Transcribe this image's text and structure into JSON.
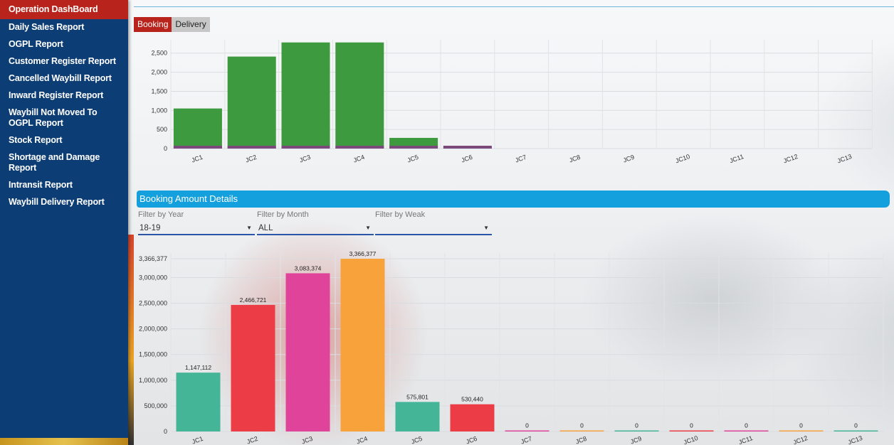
{
  "sidebar": {
    "items": [
      {
        "label": "Operation DashBoard",
        "active": true
      },
      {
        "label": "Daily Sales Report"
      },
      {
        "label": "OGPL Report"
      },
      {
        "label": "Customer Register Report"
      },
      {
        "label": "Cancelled Waybill Report"
      },
      {
        "label": "Inward Register Report"
      },
      {
        "label": "Waybill Not Moved To OGPL Report"
      },
      {
        "label": "Stock Report"
      },
      {
        "label": "Shortage and Damage Report"
      },
      {
        "label": "Intransit Report"
      },
      {
        "label": "Waybill Delivery Report"
      }
    ]
  },
  "tabs": [
    {
      "label": "Booking",
      "active": true
    },
    {
      "label": "Delivery",
      "active": false
    }
  ],
  "booking_amount": {
    "title": "Booking Amount Details",
    "filters": [
      {
        "label": "Filter by Year",
        "value": "18-19"
      },
      {
        "label": "Filter by Month",
        "value": "ALL"
      },
      {
        "label": "Filter by Weak",
        "value": ""
      }
    ]
  },
  "colors": {
    "sidebar_bg": "#0d3d75",
    "active_red": "#b8241c",
    "header_blue": "#14a0dc",
    "green": "#3e9a3e",
    "teal": "#45b597",
    "red": "#ec3d46",
    "magenta": "#e0449a",
    "orange": "#f8a23c"
  },
  "chart_data": [
    {
      "type": "bar",
      "categories": [
        "JC1",
        "JC2",
        "JC3",
        "JC4",
        "JC5",
        "JC6",
        "JC7",
        "JC8",
        "JC9",
        "JC10",
        "JC11",
        "JC12",
        "JC13"
      ],
      "values": [
        1050,
        2410,
        2780,
        2780,
        280,
        35,
        0,
        0,
        0,
        0,
        0,
        0,
        0
      ],
      "ylim": [
        0,
        2700
      ],
      "yticks": [
        "0",
        "500",
        "1,000",
        "1,500",
        "2,000",
        "2,500"
      ],
      "grid": true,
      "colors": [
        "#3e9a3e"
      ]
    },
    {
      "type": "bar",
      "categories": [
        "JC1",
        "JC2",
        "JC3",
        "JC4",
        "JC5",
        "JC6",
        "JC7",
        "JC8",
        "JC9",
        "JC10",
        "JC11",
        "JC12",
        "JC13"
      ],
      "values": [
        1147112,
        2466721,
        3083374,
        3366377,
        575801,
        530440,
        0,
        0,
        0,
        0,
        0,
        0,
        0
      ],
      "data_labels": [
        "1,147,112",
        "2,466,721",
        "3,083,374",
        "3,366,377",
        "575,801",
        "530,440",
        "0",
        "0",
        "0",
        "0",
        "0",
        "0",
        "0"
      ],
      "ylim": [
        0,
        3366377
      ],
      "yticks": [
        "0",
        "500,000",
        "1,000,000",
        "1,500,000",
        "2,000,000",
        "2,500,000",
        "3,000,000",
        "3,366,377"
      ],
      "grid": true,
      "colors": [
        "#45b597",
        "#ec3d46",
        "#e0449a",
        "#f8a23c",
        "#45b597",
        "#ec3d46",
        "#e0449a",
        "#f8a23c",
        "#45b597",
        "#ec3d46",
        "#e0449a",
        "#f8a23c",
        "#45b597"
      ]
    }
  ]
}
